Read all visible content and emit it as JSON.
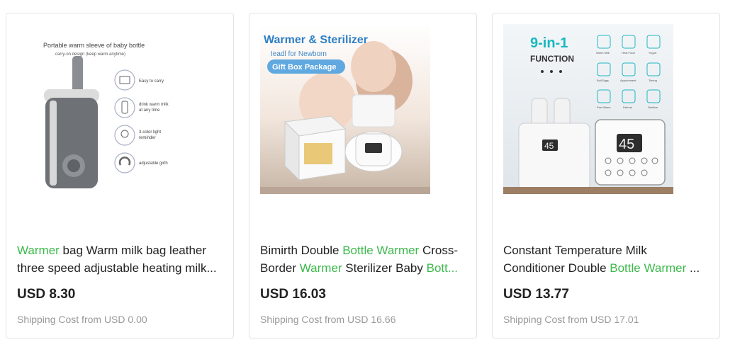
{
  "products": [
    {
      "image_texts": {
        "heading": "Portable warm sleeve of baby bottle",
        "subheading": "carry-on design (keep warm anytime)",
        "features": [
          "Easy to carry",
          "drink warm milk",
          "at any time",
          "3-color light",
          "reminder",
          "adjustable girth"
        ]
      },
      "title_line1": [
        "Warmer",
        " bag Warm milk bag leather"
      ],
      "title_line2": "three speed adjustable heating milk...",
      "price": "USD 8.30",
      "shipping": "Shipping Cost from USD 0.00"
    },
    {
      "image_texts": {
        "heading": "Warmer & Sterilizer",
        "subheading": "Ieadl for Newborn",
        "badge": "Gift Box Package"
      },
      "title_line1": [
        "Bimirth Double ",
        "Bottle Warmer",
        " Cross-"
      ],
      "title_line2": [
        "Border ",
        "Warmer",
        " Sterilizer Baby ",
        "Bott..."
      ],
      "price": "USD 16.03",
      "shipping": "Shipping Cost from USD 16.66"
    },
    {
      "image_texts": {
        "heading": "9-in-1",
        "subheading": "FUNCTION",
        "display": "45",
        "functions": [
          "Warm Milk",
          "Heat Food",
          "Yogurt",
          "Boil Eggs",
          "Appointment",
          "Timing",
          "Fast Warm",
          "Defrost",
          "Sterilize"
        ]
      },
      "title_line1": "Constant Temperature Milk",
      "title_line2": [
        "Conditioner Double ",
        "Bottle Warmer",
        " ..."
      ],
      "price": "USD 13.77",
      "shipping": "Shipping Cost from USD 17.01"
    }
  ],
  "colors": {
    "highlight": "#3cb94b",
    "price": "#222222",
    "shipping": "#999999"
  }
}
